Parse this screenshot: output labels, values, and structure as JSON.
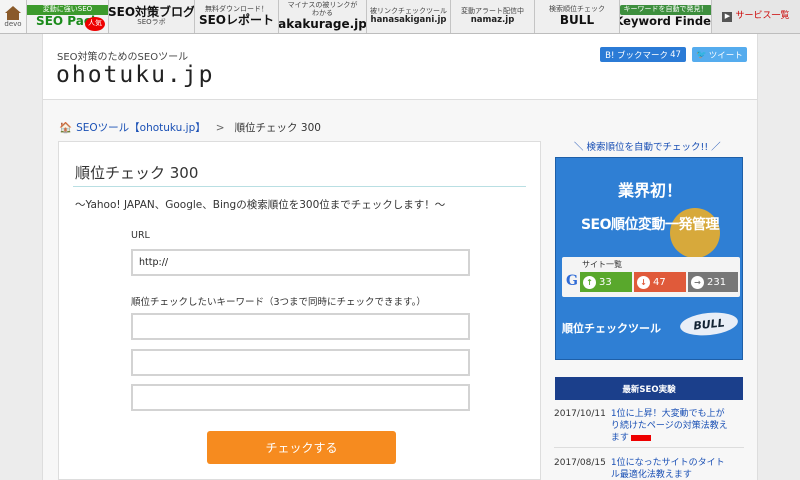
{
  "topbar": {
    "devo": "devo",
    "seopack_top": "変動に強いSEO",
    "seopack_name": "SEO Pack",
    "seopack_badge": "人気",
    "blog_title": "SEO対策ブログ",
    "blog_sub": "SEOラボ",
    "report_top": "無料ダウンロード！",
    "report_title": "SEOレポート",
    "aku_top1": "マイナスの被リンクが",
    "aku_top2": "わかる",
    "aku_title": "akakurage.jp",
    "hana_top": "被リンクチェックツール",
    "hana_title": "hanasakigani.jp",
    "namaz_top": "変動アラート配信中",
    "namaz_title": "namaz.jp",
    "bull_top": "検索順位チェック",
    "bull_title": "BULL",
    "kf_top": "キーワードを自動で発見！",
    "kf_title": "Keyword Finder",
    "service_label": "サービス一覧"
  },
  "header": {
    "tagline": "SEO対策のためのSEOツール",
    "logo": "ohotuku.jp",
    "hatena_label": "B! ブックマーク",
    "hatena_count": "47",
    "tweet_label": "ツイート"
  },
  "breadcrumb": {
    "home": "SEOツール【ohotuku.jp】",
    "separator": ">",
    "current": "順位チェック 300"
  },
  "main": {
    "title": "順位チェック 300",
    "description": "〜Yahoo! JAPAN、Google、Bingの検索順位を300位までチェックします！〜",
    "url_label": "URL",
    "url_value": "http://",
    "keyword_label": "順位チェックしたいキーワード（3つまで同時にチェックできます。）",
    "keywords": [
      "",
      "",
      ""
    ],
    "submit_label": "チェックする"
  },
  "sidebar": {
    "promo_link": "＼ 検索順位を自動でチェック!! ／",
    "banner": {
      "headline": "業界初！",
      "subline": "SEO順位変動一発管理",
      "panel_label": "サイト一覧",
      "engine": "G",
      "up_count": "33",
      "down_count": "47",
      "same_count": "231",
      "tool_label": "順位チェックツール",
      "brand": "BULL"
    },
    "news_heading": "最新SEO実験",
    "news": [
      {
        "date": "2017/10/11",
        "text": "1位に上昇！大変動でも上がり続けたページの対策法教えます"
      },
      {
        "date": "2017/08/15",
        "text": "1位になったサイトのタイトル最適化法教えます"
      }
    ]
  },
  "colors": {
    "accent_orange": "#f68b1f",
    "banner_blue": "#2f7fd4",
    "news_navy": "#1b3f8b",
    "link_blue": "#1a50b5"
  }
}
